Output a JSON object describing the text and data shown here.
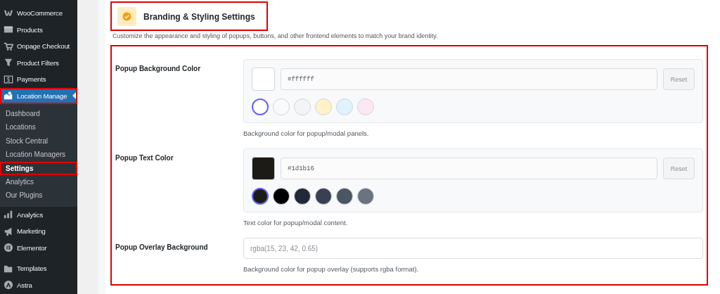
{
  "sidebar": {
    "items": [
      {
        "label": "WooCommerce",
        "current": false,
        "highlighted": false
      },
      {
        "label": "Products",
        "current": false,
        "highlighted": false
      },
      {
        "label": "Onpage Checkout",
        "current": false,
        "highlighted": false
      },
      {
        "label": "Product Filters",
        "current": false,
        "highlighted": false
      },
      {
        "label": "Payments",
        "current": false,
        "highlighted": false
      },
      {
        "label": "Location Manage",
        "current": true,
        "highlighted": true,
        "children": [
          {
            "label": "Dashboard",
            "selected": false,
            "highlighted": false
          },
          {
            "label": "Locations",
            "selected": false,
            "highlighted": false
          },
          {
            "label": "Stock Central",
            "selected": false,
            "highlighted": false
          },
          {
            "label": "Location Managers",
            "selected": false,
            "highlighted": false
          },
          {
            "label": "Settings",
            "selected": true,
            "highlighted": true
          },
          {
            "label": "Analytics",
            "selected": false,
            "highlighted": false
          },
          {
            "label": "Our Plugins",
            "selected": false,
            "highlighted": false
          }
        ]
      },
      {
        "label": "Analytics",
        "current": false,
        "highlighted": false
      },
      {
        "label": "Marketing",
        "current": false,
        "highlighted": false
      },
      {
        "label": "Elementor",
        "current": false,
        "highlighted": false
      },
      {
        "label": "Templates",
        "current": false,
        "highlighted": false
      },
      {
        "label": "Astra",
        "current": false,
        "highlighted": false
      }
    ]
  },
  "section": {
    "title": "Branding & Styling Settings",
    "highlighted": true,
    "description": "Customize the appearance and styling of popups, buttons, and other frontend elements to match your brand identity.",
    "fields_highlighted": true,
    "fields": [
      {
        "kind": "color",
        "label": "Popup Background Color",
        "value": "#ffffff",
        "color": "#ffffff",
        "reset": "Reset",
        "help": "Background color for popup/modal panels.",
        "swatches": [
          {
            "color": "#ffffff",
            "selected": true
          },
          {
            "color": "#f9fafb",
            "selected": false
          },
          {
            "color": "#f3f4f6",
            "selected": false
          },
          {
            "color": "#fef3c7",
            "selected": false
          },
          {
            "color": "#e0f2fe",
            "selected": false
          },
          {
            "color": "#fce7f3",
            "selected": false
          }
        ]
      },
      {
        "kind": "color",
        "label": "Popup Text Color",
        "value": "#1d1b16",
        "color": "#1d1b16",
        "reset": "Reset",
        "help": "Text color for popup/modal content.",
        "swatches": [
          {
            "color": "#1d1b16",
            "selected": true
          },
          {
            "color": "#000000",
            "selected": false
          },
          {
            "color": "#1f2937",
            "selected": false
          },
          {
            "color": "#374151",
            "selected": false
          },
          {
            "color": "#4b5563",
            "selected": false
          },
          {
            "color": "#6b7280",
            "selected": false
          }
        ]
      },
      {
        "kind": "text",
        "label": "Popup Overlay Background",
        "placeholder": "rgba(15, 23, 42, 0.65)",
        "help": "Background color for popup overlay (supports rgba format)."
      }
    ]
  }
}
